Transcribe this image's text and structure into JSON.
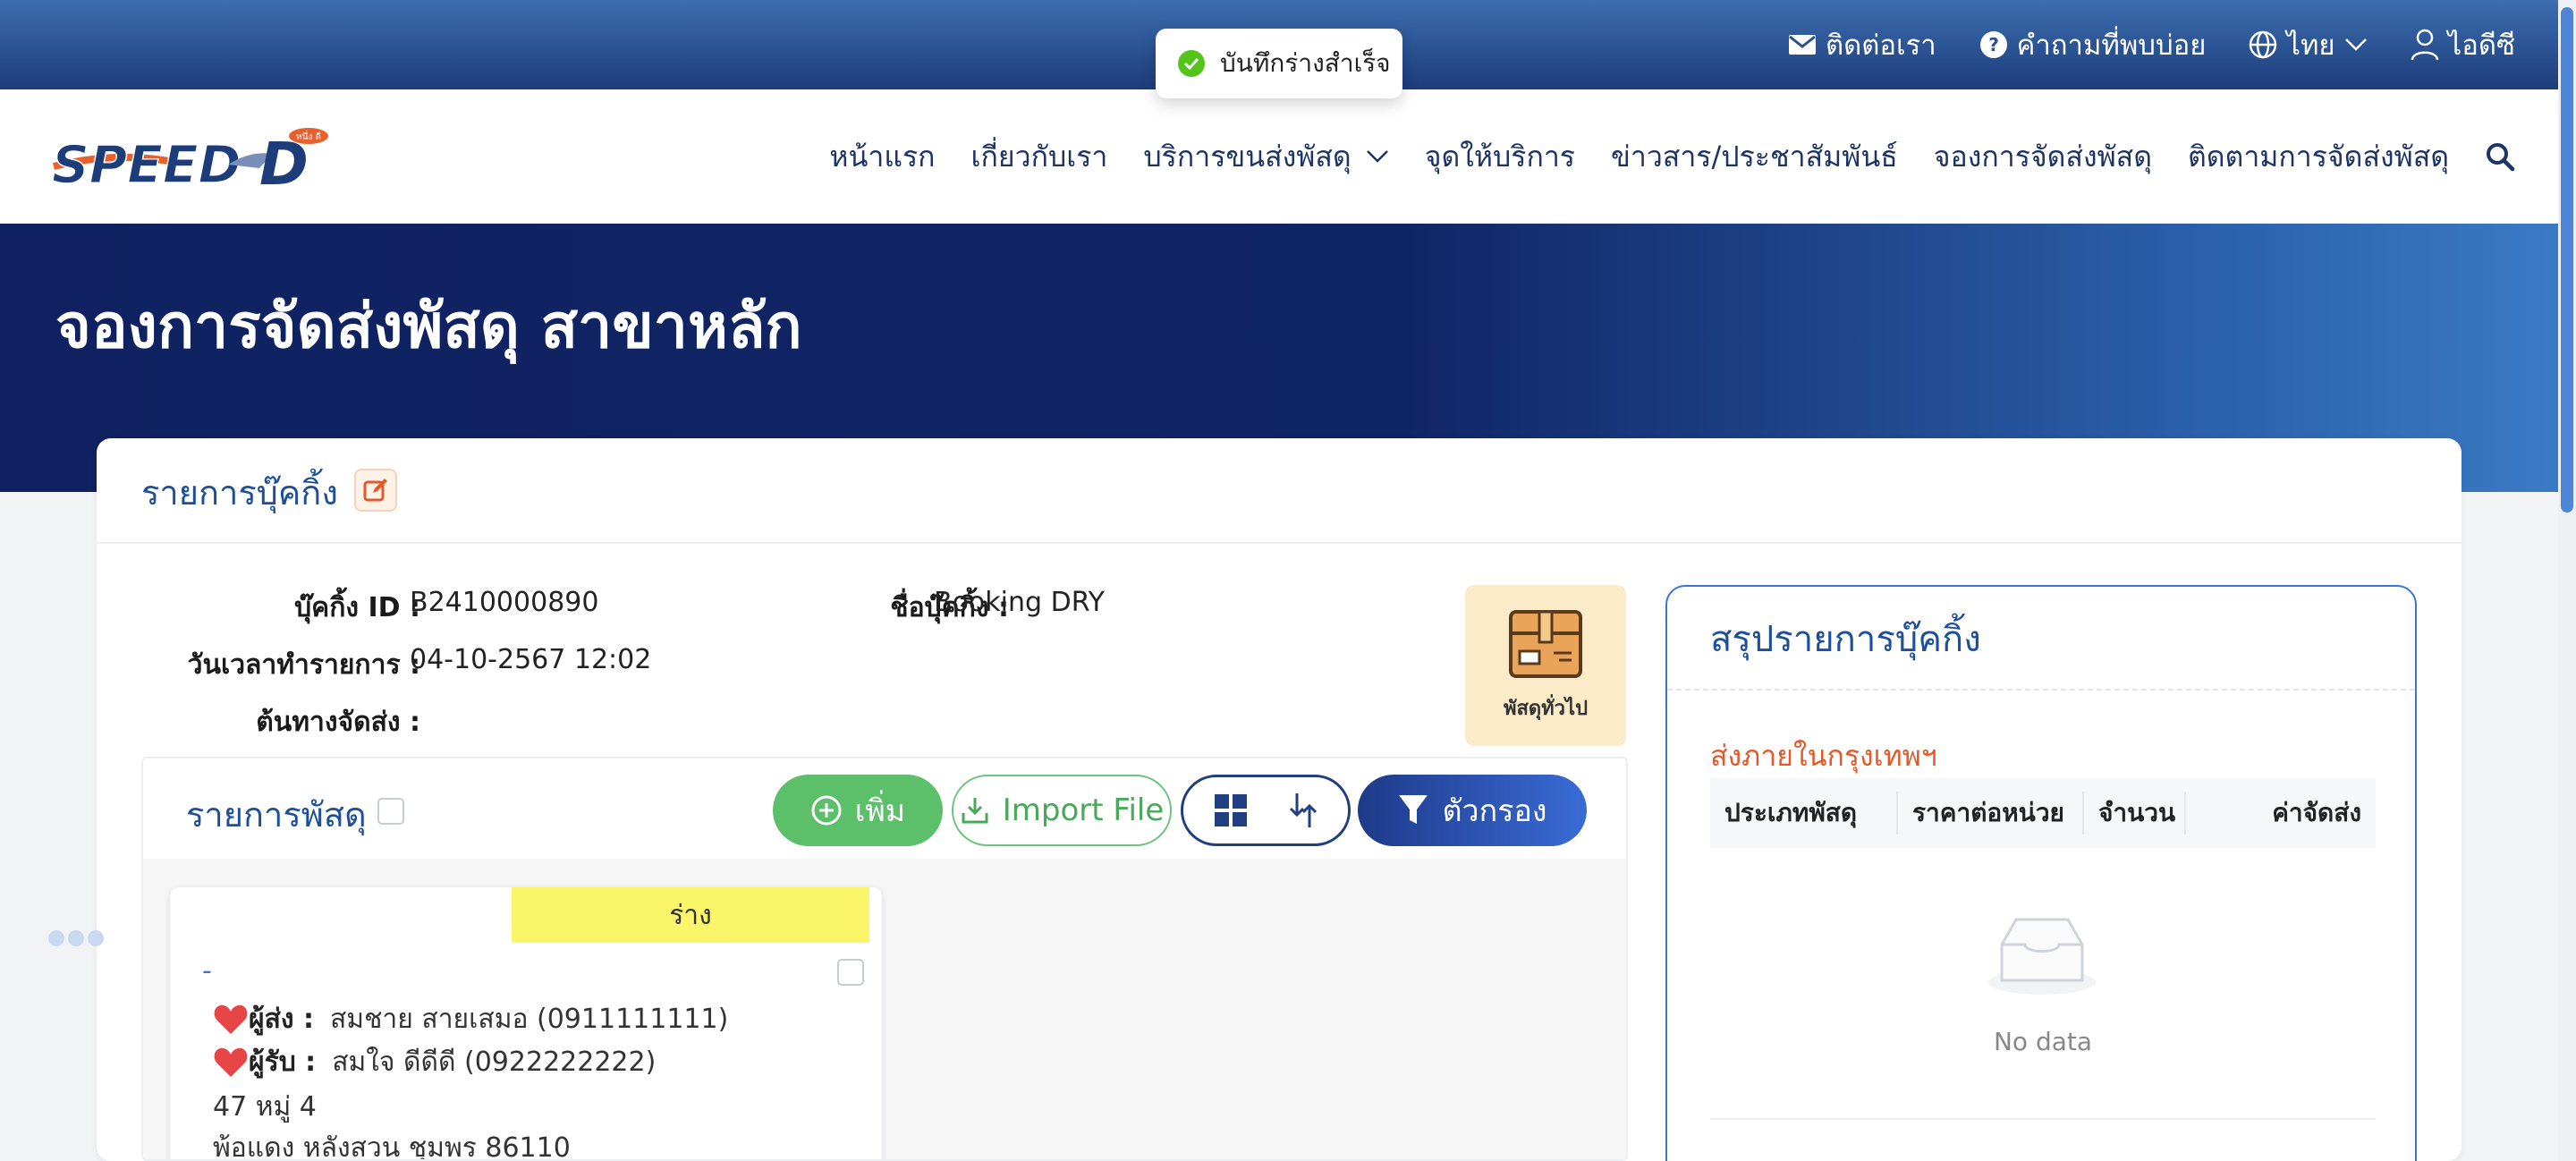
{
  "topbar": {
    "contact": "ติดต่อเรา",
    "faq": "คำถามที่พบบ่อย",
    "language": "ไทย",
    "user": "ไอดีซี"
  },
  "toast": {
    "message": "บันทึกร่างสำเร็จ"
  },
  "brand": {
    "name": "SPEED",
    "letter": "D",
    "tag": "หนึ่ง ดี"
  },
  "nav": {
    "items": [
      "หน้าแรก",
      "เกี่ยวกับเรา",
      "บริการขนส่งพัสดุ",
      "จุดให้บริการ",
      "ข่าวสาร/ประชาสัมพันธ์",
      "จองการจัดส่งพัสดุ",
      "ติดตามการจัดส่งพัสดุ"
    ]
  },
  "hero": {
    "title": "จองการจัดส่งพัสดุ สาขาหลัก"
  },
  "booking": {
    "section_title": "รายการบุ๊คกิ้ง",
    "id_label": "บุ๊คกิ้ง ID :",
    "id_value": "B2410000890",
    "name_label": "ชื่อบุ๊คกิ้ง :",
    "name_value": "Booking DRY",
    "datetime_label": "วันเวลาทำรายการ :",
    "datetime_value": "04-10-2567 12:02",
    "origin_label": "ต้นทางจัดส่ง :",
    "origin_value": "",
    "package_type": "พัสดุทั่วไป"
  },
  "parcels": {
    "title": "รายการพัสดุ",
    "add_label": "เพิ่ม",
    "import_label": "Import File",
    "filter_label": "ตัวกรอง",
    "card": {
      "status": "ร่าง",
      "code": "-",
      "sender_label": "ผู้ส่ง :",
      "sender_value": "สมชาย สายเสมอ  (0911111111)",
      "receiver_label": "ผู้รับ :",
      "receiver_value": "สมใจ ดีดีดี  (0922222222)",
      "address1": "47 หมู่ 4",
      "address2": "พ้อแดง หลังสวน ชุมพร 86110"
    }
  },
  "summary": {
    "title": "สรุปรายการบุ๊คกิ้ง",
    "zone": "ส่งภายในกรุงเทพฯ",
    "columns": [
      "ประเภทพัสดุ",
      "ราคาต่อหน่วย",
      "จำนวน",
      "ค่าจัดส่ง"
    ],
    "empty_text": "No data"
  },
  "colors": {
    "brand_navy": "#0f2160",
    "accent_orange": "#e2592a",
    "success_green": "#5cbf6a",
    "draft_yellow": "#fbf56a"
  }
}
